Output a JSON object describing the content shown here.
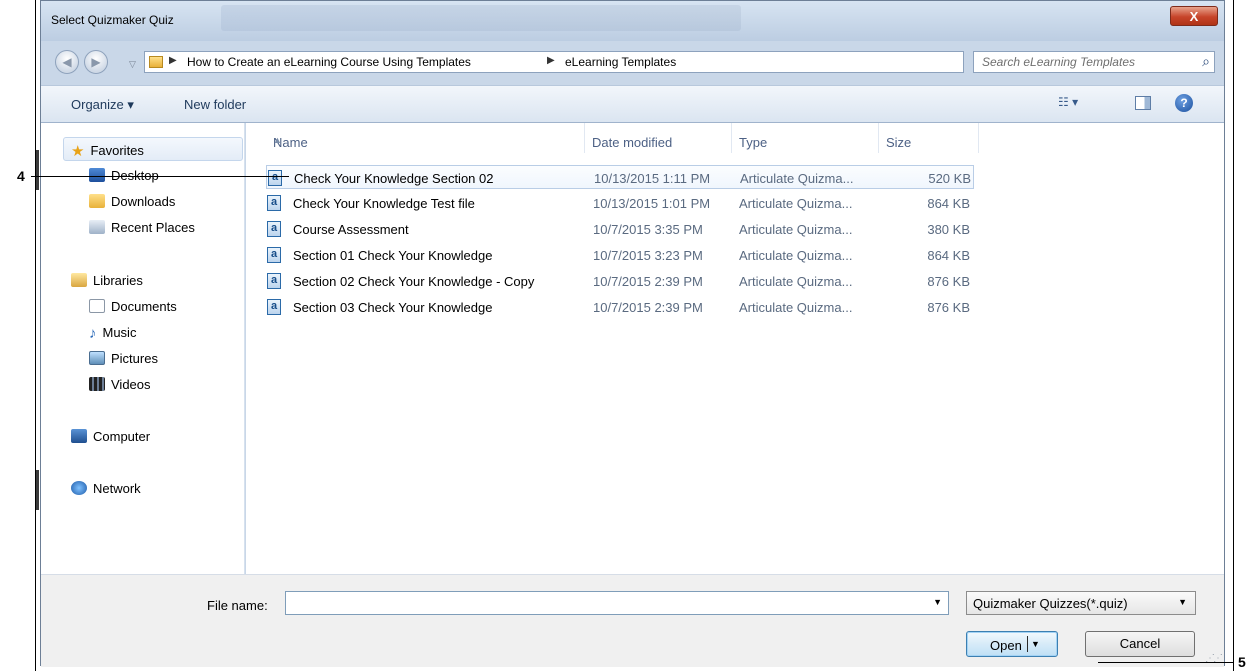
{
  "window": {
    "title": "Select Quizmaker Quiz",
    "close_label": "X"
  },
  "address_bar": {
    "crumbs": [
      "How to Create an eLearning Course Using Templates",
      "eLearning Templates"
    ],
    "search_placeholder": "Search eLearning Templates"
  },
  "toolbar": {
    "organize_label": "Organize ▾",
    "new_folder_label": "New folder"
  },
  "nav_pane": {
    "favorites": "Favorites",
    "desktop": "Desktop",
    "downloads": "Downloads",
    "recent_places": "Recent Places",
    "libraries": "Libraries",
    "documents": "Documents",
    "music": "Music",
    "pictures": "Pictures",
    "videos": "Videos",
    "computer": "Computer",
    "network": "Network"
  },
  "file_list": {
    "columns": [
      "Name",
      "Date modified",
      "Type",
      "Size"
    ],
    "rows": [
      {
        "name": "Check Your Knowledge Section 02",
        "date": "10/13/2015 1:11 PM",
        "type": "Articulate Quizma...",
        "size": "520 KB"
      },
      {
        "name": "Check Your Knowledge Test file",
        "date": "10/13/2015 1:01 PM",
        "type": "Articulate Quizma...",
        "size": "864 KB"
      },
      {
        "name": "Course Assessment",
        "date": "10/7/2015 3:35 PM",
        "type": "Articulate Quizma...",
        "size": "380 KB"
      },
      {
        "name": "Section 01 Check Your Knowledge",
        "date": "10/7/2015 3:23 PM",
        "type": "Articulate Quizma...",
        "size": "864 KB"
      },
      {
        "name": "Section 02 Check Your Knowledge - Copy",
        "date": "10/7/2015 2:39 PM",
        "type": "Articulate Quizma...",
        "size": "876 KB"
      },
      {
        "name": "Section 03 Check Your Knowledge",
        "date": "10/7/2015 2:39 PM",
        "type": "Articulate Quizma...",
        "size": "876 KB"
      }
    ]
  },
  "bottom": {
    "file_name_label": "File name:",
    "file_name_value": "",
    "filter_value": "Quizmaker Quizzes(*.quiz)",
    "open_label": "Open",
    "cancel_label": "Cancel"
  },
  "callouts": {
    "step4": "4",
    "step5": "5"
  },
  "colors": {
    "accent": "#2b6aa8",
    "close_red": "#c7442a"
  }
}
